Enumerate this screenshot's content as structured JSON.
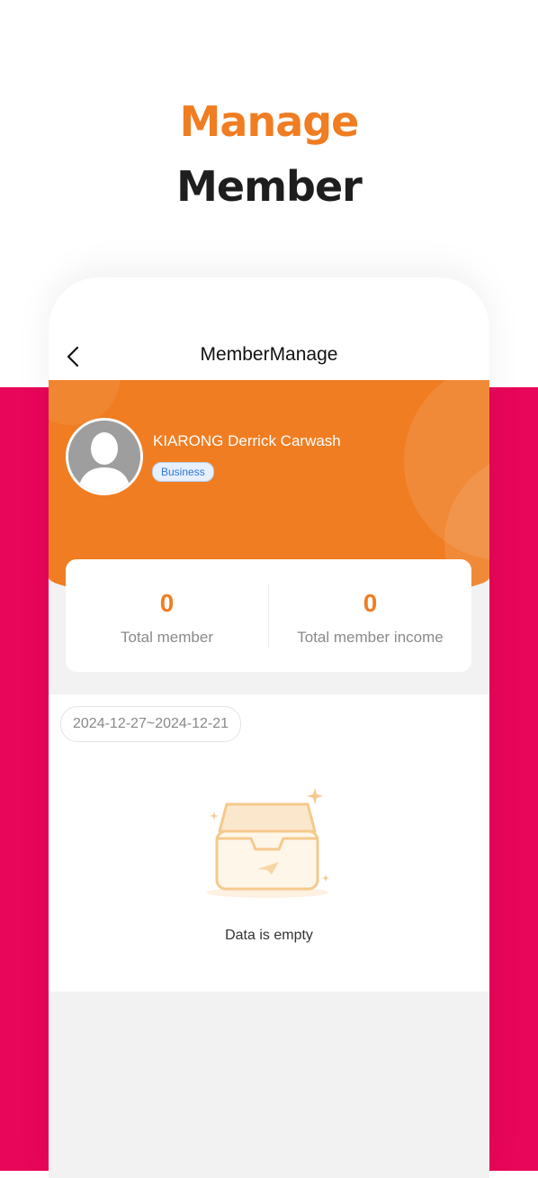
{
  "hero": {
    "line1": "Manage",
    "line2": "Member"
  },
  "nav": {
    "title": "MemberManage",
    "back_icon": "back-chevron-icon"
  },
  "profile": {
    "name": "KIARONG Derrick Carwash",
    "badge": "Business",
    "avatar_icon": "default-user-avatar-icon"
  },
  "stats": {
    "total_member_value": "0",
    "total_member_label": "Total member",
    "total_income_value": "0",
    "total_income_label": "Total member income"
  },
  "filter": {
    "date_range": "2024-12-27~2024-12-21"
  },
  "empty_state": {
    "icon": "empty-inbox-icon",
    "message": "Data is empty"
  },
  "colors": {
    "accent_orange": "#f07d22",
    "background_pink": "#e8065a",
    "badge_blue": "#2f78d8",
    "page_gray": "#f2f2f2"
  }
}
